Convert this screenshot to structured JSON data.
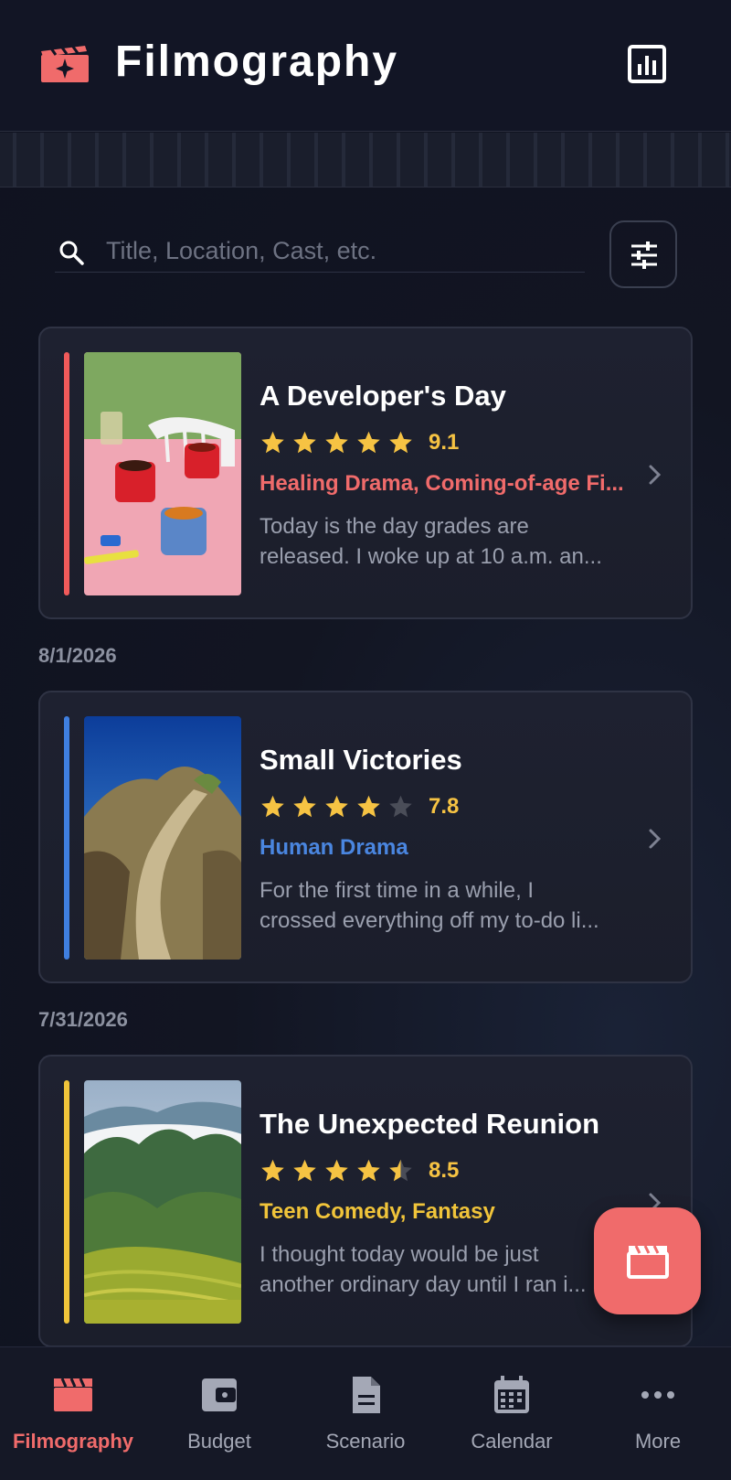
{
  "header": {
    "title": "Filmography",
    "logo_icon": "clapperboard-sparkle-icon",
    "stats_icon": "bar-chart-icon"
  },
  "search": {
    "placeholder": "Title, Location, Cast, etc.",
    "value": "",
    "filter_icon": "sliders-icon"
  },
  "entries": [
    {
      "title": "A Developer's Day",
      "stars": 4.5,
      "rating": "9.1",
      "genres": "Healing Drama, Coming-of-age Fi...",
      "desc_line1": "Today is the day grades are",
      "desc_line2": "released. I woke up at 10 a.m. an...",
      "accent_color": "#f05a5a",
      "genre_color": "#f06b6b"
    },
    {
      "date": "8/1/2026",
      "title": "Small Victories",
      "stars": 4,
      "rating": "7.8",
      "genres": "Human Drama",
      "desc_line1": "For the first time in a while, I",
      "desc_line2": "crossed everything off my to-do li...",
      "accent_color": "#3f7fe0",
      "genre_color": "#4a86e0"
    },
    {
      "date": "7/31/2026",
      "title": "The Unexpected Reunion",
      "stars": 4.5,
      "rating": "8.5",
      "genres": "Teen Comedy, Fantasy",
      "desc_line1": "I thought today would be just",
      "desc_line2": "another ordinary day until I ran i...",
      "accent_color": "#f0c43a",
      "genre_color": "#f0c43a"
    }
  ],
  "fab": {
    "icon": "clapperboard-icon"
  },
  "nav": [
    {
      "label": "Filmography",
      "icon": "clapperboard-icon",
      "active": true
    },
    {
      "label": "Budget",
      "icon": "wallet-icon",
      "active": false
    },
    {
      "label": "Scenario",
      "icon": "document-icon",
      "active": false
    },
    {
      "label": "Calendar",
      "icon": "calendar-icon",
      "active": false
    },
    {
      "label": "More",
      "icon": "more-dots-icon",
      "active": false
    }
  ],
  "colors": {
    "accent": "#f06b6b",
    "star": "#f6c343",
    "star_empty": "#4a4d58"
  }
}
